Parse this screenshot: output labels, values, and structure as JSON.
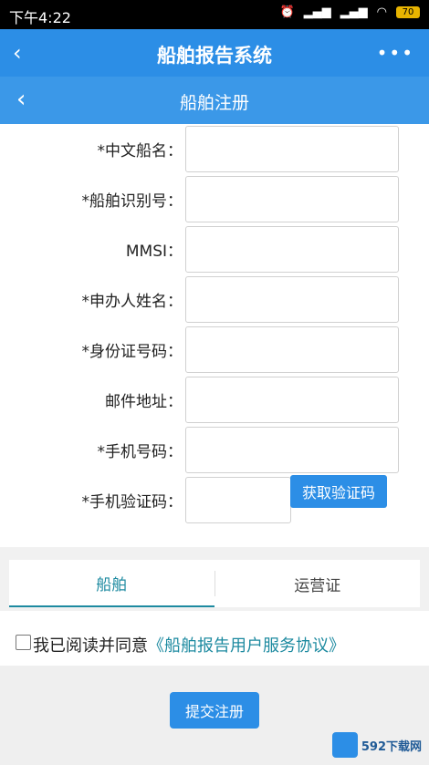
{
  "status": {
    "time": "下午4:22",
    "battery": "70"
  },
  "appbar": {
    "title": "船舶报告系统",
    "more": "•••"
  },
  "subbar": {
    "title": "船舶注册"
  },
  "form": {
    "fields": [
      {
        "label": "*中文船名："
      },
      {
        "label": "*船舶识别号："
      },
      {
        "label": "MMSI："
      },
      {
        "label": "*申办人姓名："
      },
      {
        "label": "*身份证号码："
      },
      {
        "label": "邮件地址："
      },
      {
        "label": "*手机号码："
      },
      {
        "label": "*手机验证码："
      }
    ],
    "get_code_button": "获取验证码"
  },
  "tabs": {
    "items": [
      "船舶",
      "运营证"
    ],
    "active": 0
  },
  "agreement": {
    "text": "我已阅读并同意",
    "link": "《船舶报告用户服务协议》"
  },
  "submit_label": "提交注册",
  "watermark": {
    "text": "592下载网"
  },
  "colors": {
    "primary": "#2c8ee6",
    "accent": "#1d8aa0"
  }
}
